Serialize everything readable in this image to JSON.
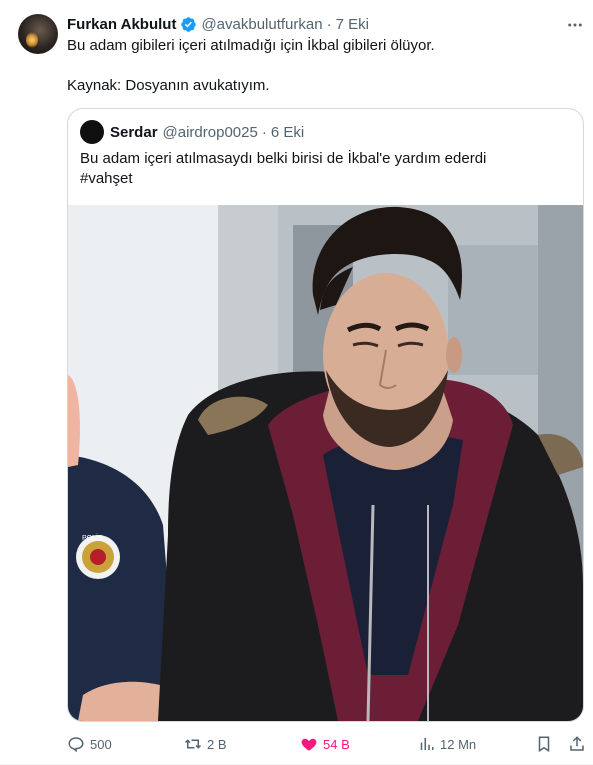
{
  "tweet": {
    "author_name": "Furkan Akbulut",
    "author_handle": "@avakbulutfurkan",
    "separator": "·",
    "time": "7 Eki",
    "text_line1": "Bu adam gibileri içeri atılmadığı için İkbal gibileri ölüyor.",
    "text_line2": "Kaynak: Dosyanın avukatıyım."
  },
  "quote": {
    "author_name": "Serdar",
    "author_handle": "@airdrop0025",
    "separator": "·",
    "time": "6 Eki",
    "text_line1": "Bu adam içeri atılmasaydı belki birisi de İkbal'e yardım ederdi",
    "text_line2": "#vahşet",
    "police_badge_text": "POLİS"
  },
  "actions": {
    "replies": "500",
    "retweets": "2 B",
    "likes": "54 B",
    "views": "12 Mn"
  },
  "colors": {
    "like_active": "#f91880",
    "verified": "#1d9bf0",
    "secondary_text": "#536471",
    "border": "#cfd9de"
  },
  "icons": [
    "more-icon",
    "verified-icon",
    "reply-icon",
    "retweet-icon",
    "like-icon",
    "views-icon",
    "bookmark-icon",
    "share-icon"
  ]
}
